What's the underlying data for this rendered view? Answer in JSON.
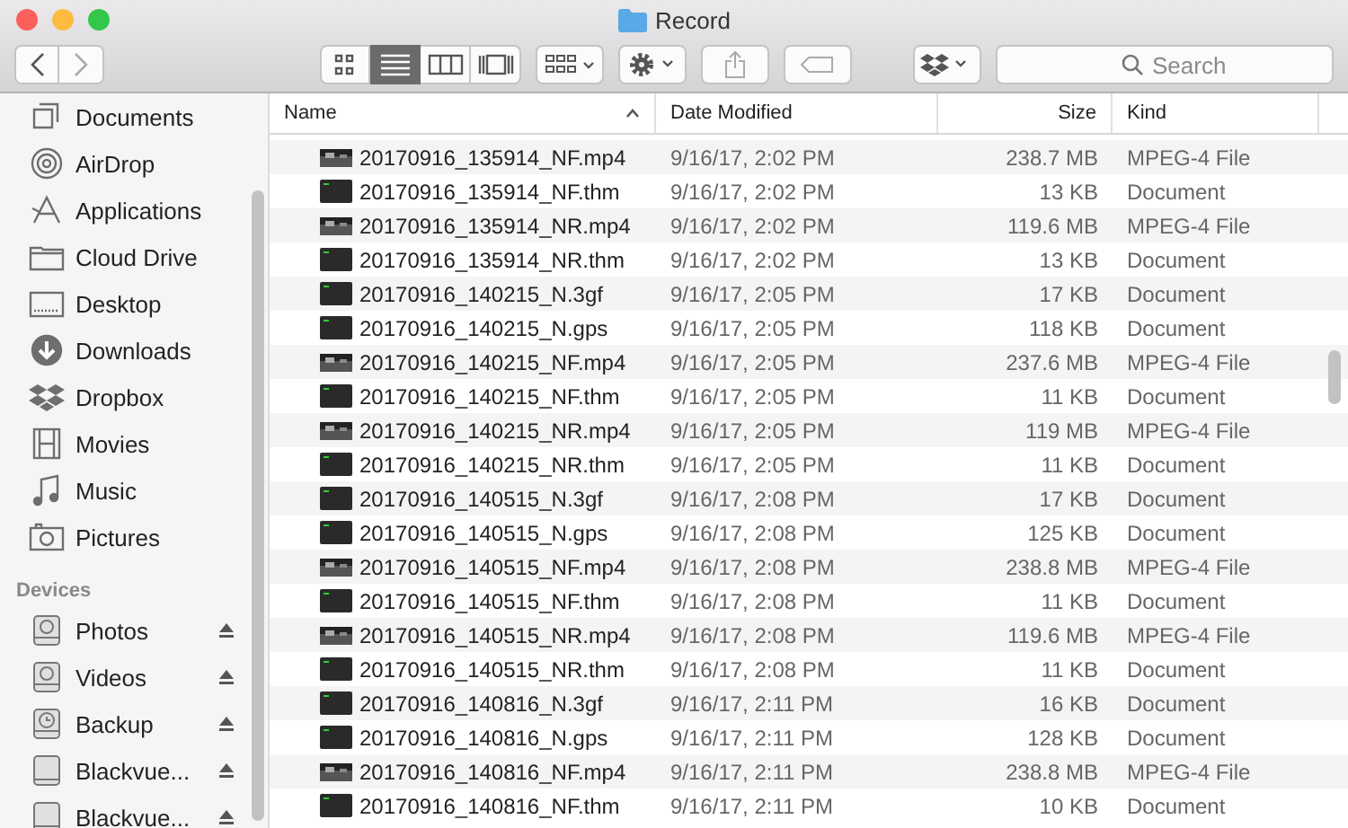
{
  "window": {
    "title": "Record"
  },
  "toolbar": {
    "view_modes": [
      {
        "selected": false
      },
      {
        "selected": true
      },
      {
        "selected": false
      },
      {
        "selected": false
      }
    ],
    "search": {
      "placeholder": "Search"
    }
  },
  "sidebar": {
    "favorites": [
      {
        "label": "Documents"
      },
      {
        "label": "AirDrop"
      },
      {
        "label": "Applications"
      },
      {
        "label": "Cloud Drive"
      },
      {
        "label": "Desktop"
      },
      {
        "label": "Downloads"
      },
      {
        "label": "Dropbox"
      },
      {
        "label": "Movies"
      },
      {
        "label": "Music"
      },
      {
        "label": "Pictures"
      }
    ],
    "devices_heading": "Devices",
    "devices": [
      {
        "label": "Photos"
      },
      {
        "label": "Videos"
      },
      {
        "label": "Backup"
      },
      {
        "label": "Blackvue..."
      },
      {
        "label": "Blackvue..."
      }
    ]
  },
  "table": {
    "columns": [
      "Name",
      "Date Modified",
      "Size",
      "Kind"
    ],
    "rows": [
      {
        "kind": "video",
        "name": "20170916_135914_NF.mp4",
        "date": "9/16/17, 2:02 PM",
        "size": "238.7 MB",
        "type": "MPEG-4 File"
      },
      {
        "kind": "document",
        "name": "20170916_135914_NF.thm",
        "date": "9/16/17, 2:02 PM",
        "size": "13 KB",
        "type": "Document"
      },
      {
        "kind": "video",
        "name": "20170916_135914_NR.mp4",
        "date": "9/16/17, 2:02 PM",
        "size": "119.6 MB",
        "type": "MPEG-4 File"
      },
      {
        "kind": "document",
        "name": "20170916_135914_NR.thm",
        "date": "9/16/17, 2:02 PM",
        "size": "13 KB",
        "type": "Document"
      },
      {
        "kind": "document",
        "name": "20170916_140215_N.3gf",
        "date": "9/16/17, 2:05 PM",
        "size": "17 KB",
        "type": "Document"
      },
      {
        "kind": "document",
        "name": "20170916_140215_N.gps",
        "date": "9/16/17, 2:05 PM",
        "size": "118 KB",
        "type": "Document"
      },
      {
        "kind": "video",
        "name": "20170916_140215_NF.mp4",
        "date": "9/16/17, 2:05 PM",
        "size": "237.6 MB",
        "type": "MPEG-4 File"
      },
      {
        "kind": "document",
        "name": "20170916_140215_NF.thm",
        "date": "9/16/17, 2:05 PM",
        "size": "11 KB",
        "type": "Document"
      },
      {
        "kind": "video",
        "name": "20170916_140215_NR.mp4",
        "date": "9/16/17, 2:05 PM",
        "size": "119 MB",
        "type": "MPEG-4 File"
      },
      {
        "kind": "document",
        "name": "20170916_140215_NR.thm",
        "date": "9/16/17, 2:05 PM",
        "size": "11 KB",
        "type": "Document"
      },
      {
        "kind": "document",
        "name": "20170916_140515_N.3gf",
        "date": "9/16/17, 2:08 PM",
        "size": "17 KB",
        "type": "Document"
      },
      {
        "kind": "document",
        "name": "20170916_140515_N.gps",
        "date": "9/16/17, 2:08 PM",
        "size": "125 KB",
        "type": "Document"
      },
      {
        "kind": "video",
        "name": "20170916_140515_NF.mp4",
        "date": "9/16/17, 2:08 PM",
        "size": "238.8 MB",
        "type": "MPEG-4 File"
      },
      {
        "kind": "document",
        "name": "20170916_140515_NF.thm",
        "date": "9/16/17, 2:08 PM",
        "size": "11 KB",
        "type": "Document"
      },
      {
        "kind": "video",
        "name": "20170916_140515_NR.mp4",
        "date": "9/16/17, 2:08 PM",
        "size": "119.6 MB",
        "type": "MPEG-4 File"
      },
      {
        "kind": "document",
        "name": "20170916_140515_NR.thm",
        "date": "9/16/17, 2:08 PM",
        "size": "11 KB",
        "type": "Document"
      },
      {
        "kind": "document",
        "name": "20170916_140816_N.3gf",
        "date": "9/16/17, 2:11 PM",
        "size": "16 KB",
        "type": "Document"
      },
      {
        "kind": "document",
        "name": "20170916_140816_N.gps",
        "date": "9/16/17, 2:11 PM",
        "size": "128 KB",
        "type": "Document"
      },
      {
        "kind": "video",
        "name": "20170916_140816_NF.mp4",
        "date": "9/16/17, 2:11 PM",
        "size": "238.8 MB",
        "type": "MPEG-4 File"
      },
      {
        "kind": "document",
        "name": "20170916_140816_NF.thm",
        "date": "9/16/17, 2:11 PM",
        "size": "10 KB",
        "type": "Document"
      }
    ]
  }
}
